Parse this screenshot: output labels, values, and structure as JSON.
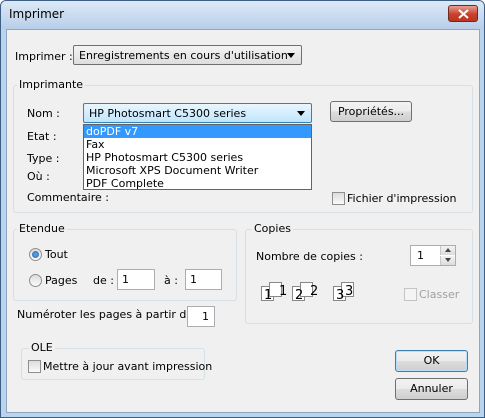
{
  "window": {
    "title": "Imprimer"
  },
  "print_scope": {
    "label": "Imprimer :",
    "value": "Enregistrements en cours d'utilisation"
  },
  "printer": {
    "group_title": "Imprimante",
    "name_label": "Nom :",
    "selected": "HP Photosmart C5300 series",
    "properties_button": "Propriétés...",
    "options": [
      "doPDF v7",
      "Fax",
      "HP Photosmart C5300 series",
      "Microsoft XPS Document Writer",
      "PDF Complete"
    ],
    "highlighted_option": "doPDF v7",
    "state_label": "Etat :",
    "type_label": "Type :",
    "where_label": "Où :",
    "comment_label": "Commentaire :",
    "print_to_file_label": "Fichier d'impression"
  },
  "range": {
    "group_title": "Etendue",
    "all_label": "Tout",
    "pages_label": "Pages",
    "from_label": "de :",
    "from_value": "1",
    "to_label": "à :",
    "to_value": "1"
  },
  "copies": {
    "group_title": "Copies",
    "count_label": "Nombre de copies :",
    "count_value": "1",
    "collate_label": "Classer",
    "collate_pages": [
      "1",
      "1",
      "2",
      "2",
      "3",
      "3"
    ]
  },
  "numbering": {
    "label": "Numéroter les pages à partir de :",
    "value": "1"
  },
  "ole": {
    "group_title": "OLE",
    "update_label": "Mettre à jour avant impression"
  },
  "buttons": {
    "ok": "OK",
    "cancel": "Annuler"
  }
}
